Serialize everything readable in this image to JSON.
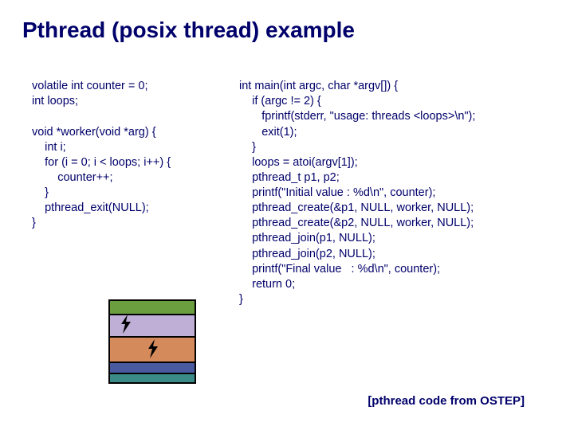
{
  "title": "Pthread (posix thread) example",
  "left": {
    "line1": "volatile int counter = 0;",
    "line2": "int loops;",
    "line3": "",
    "line4": "void *worker(void *arg) {",
    "line5": "    int i;",
    "line6": "    for (i = 0; i < loops; i++) {",
    "line7": "        counter++;",
    "line8": "    }",
    "line9": "    pthread_exit(NULL);",
    "line10": "}"
  },
  "right": {
    "line1": "int main(int argc, char *argv[]) {",
    "line2": "    if (argc != 2) {",
    "line3": "       fprintf(stderr, \"usage: threads <loops>\\n\");",
    "line4": "       exit(1);",
    "line5": "    }",
    "line6": "    loops = atoi(argv[1]);",
    "line7": "    pthread_t p1, p2;",
    "line8": "    printf(\"Initial value : %d\\n\", counter);",
    "line9": "    pthread_create(&p1, NULL, worker, NULL);",
    "line10": "    pthread_create(&p2, NULL, worker, NULL);",
    "line11": "    pthread_join(p1, NULL);",
    "line12": "    pthread_join(p2, NULL);",
    "line13": "    printf(\"Final value   : %d\\n\", counter);",
    "line14": "    return 0;",
    "line15": "}"
  },
  "attribution": "[pthread code from OSTEP]",
  "diagram": {
    "layers": [
      {
        "color": "#6b9e3f"
      },
      {
        "color": "#bfafd6"
      },
      {
        "color": "#d48a5a"
      },
      {
        "color": "#4a5aa0"
      },
      {
        "color": "#3a8a87"
      }
    ],
    "icon": "bolt"
  }
}
